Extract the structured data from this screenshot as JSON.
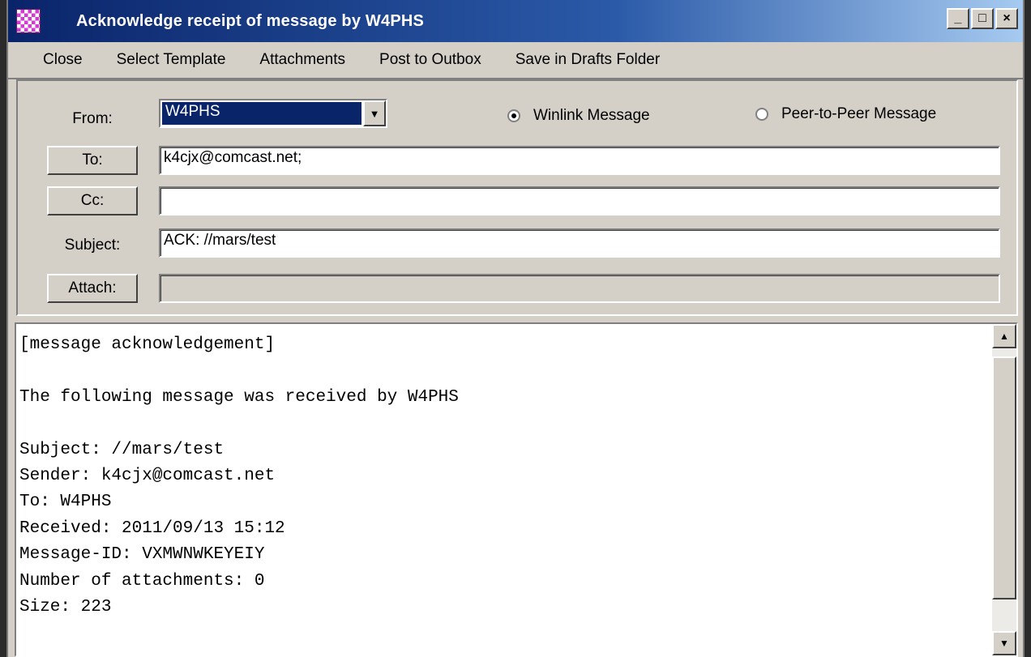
{
  "window": {
    "title": "Acknowledge receipt of message by W4PHS",
    "controls": {
      "minimize": "_",
      "maximize": "□",
      "close": "×"
    }
  },
  "menu": [
    "Close",
    "Select Template",
    "Attachments",
    "Post to Outbox",
    "Save in Drafts Folder"
  ],
  "form": {
    "from_label": "From:",
    "from_value": "W4PHS",
    "radio_winlink": "Winlink Message",
    "radio_p2p": "Peer-to-Peer Message",
    "selected_mode": "Winlink Message",
    "to_button": "To:",
    "to_value": "k4cjx@comcast.net;",
    "cc_button": "Cc:",
    "cc_value": "",
    "subject_label": "Subject:",
    "subject_value": "ACK: //mars/test",
    "attach_button": "Attach:",
    "attach_value": ""
  },
  "message_body": "[message acknowledgement]\n\nThe following message was received by W4PHS\n\nSubject: //mars/test\nSender: k4cjx@comcast.net\nTo: W4PHS\nReceived: 2011/09/13 15:12\nMessage-ID: VXMWNWKEYEIY\nNumber of attachments: 0\nSize: 223",
  "icons": {
    "app": "checkerboard-app-icon",
    "combo_arrow": "▼",
    "scroll_up": "▲",
    "scroll_down": "▼"
  }
}
